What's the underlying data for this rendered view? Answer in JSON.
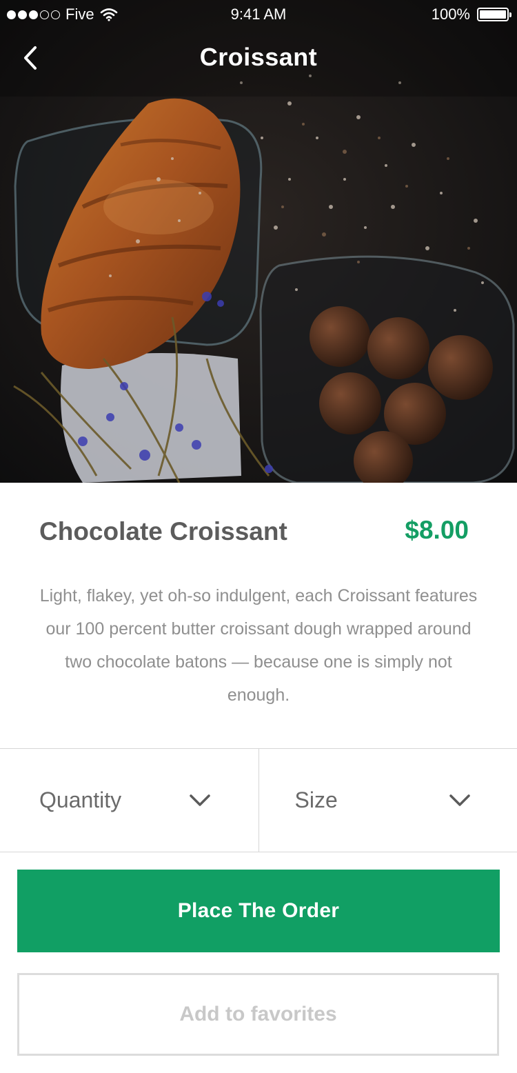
{
  "status_bar": {
    "carrier": "Five",
    "time": "9:41 AM",
    "battery": "100%",
    "signal_bars_filled": 3,
    "signal_bars_total": 5
  },
  "nav": {
    "title": "Croissant",
    "back_icon": "chevron-left-icon"
  },
  "hero": {
    "image_subject": "croissant-photo"
  },
  "product": {
    "name": "Chocolate Croissant",
    "price": "$8.00",
    "description": "Light, flakey, yet oh-so indulgent, each Croissant features our 100 percent butter croissant dough wrapped around two chocolate batons — because one is simply not enough."
  },
  "options": {
    "quantity_label": "Quantity",
    "size_label": "Size",
    "dropdown_icon": "chevron-down-icon"
  },
  "actions": {
    "order_label": "Place The Order",
    "favorites_label": "Add to favorites"
  },
  "colors": {
    "accent": "#119f64",
    "price": "#149e64",
    "text_primary": "#5c5c5c",
    "text_secondary": "#8f8f8f",
    "divider": "#d6d6d6"
  }
}
